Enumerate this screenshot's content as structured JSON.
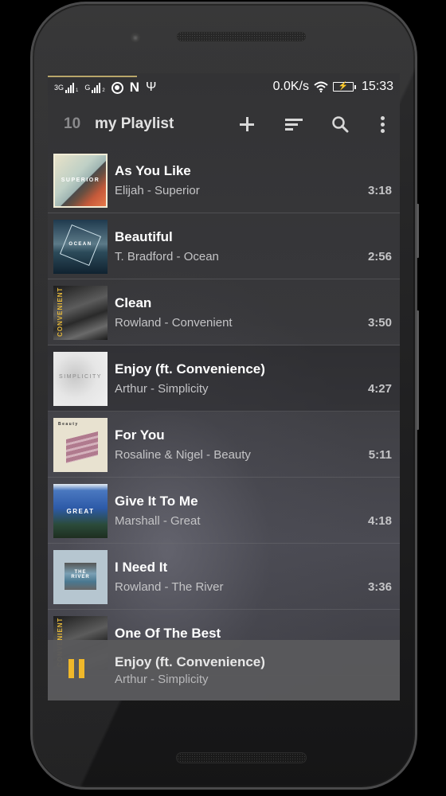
{
  "status_bar": {
    "network_1": "3G",
    "network_2": "G",
    "speed": "0.0K/s",
    "time": "15:33",
    "icons": [
      "signal-icon",
      "signal-icon",
      "sync-circle-icon",
      "n-app-icon",
      "usb-icon",
      "wifi-icon",
      "battery-charging-icon"
    ]
  },
  "app_bar": {
    "count": "10",
    "title": "my Playlist",
    "actions": [
      "add-icon",
      "sort-icon",
      "search-icon",
      "more-vert-icon"
    ]
  },
  "tracks": [
    {
      "title": "As You Like",
      "subtitle": "Elijah - Superior",
      "duration": "3:18",
      "album_text": "SUPERIOR"
    },
    {
      "title": "Beautiful",
      "subtitle": "T. Bradford - Ocean",
      "duration": "2:56",
      "album_text": "OCEAN"
    },
    {
      "title": "Clean",
      "subtitle": "Rowland - Convenient",
      "duration": "3:50",
      "album_text": "CONVENIENT"
    },
    {
      "title": "Enjoy (ft. Convenience)",
      "subtitle": "Arthur - Simplicity",
      "duration": "4:27",
      "album_text": "SIMPLICITY",
      "active": true
    },
    {
      "title": "For You",
      "subtitle": "Rosaline & Nigel - Beauty",
      "duration": "5:11",
      "album_text": "Beauty"
    },
    {
      "title": "Give It To Me",
      "subtitle": "Marshall - Great",
      "duration": "4:18",
      "album_text": "GREAT"
    },
    {
      "title": "I Need It",
      "subtitle": "Rowland - The River",
      "duration": "3:36",
      "album_text": "THE RIVER"
    },
    {
      "title": "One Of The Best",
      "subtitle": "",
      "duration": "",
      "album_text": "CONVENIENT"
    }
  ],
  "now_playing": {
    "title": "Enjoy (ft. Convenience)",
    "subtitle": "Arthur - Simplicity",
    "state": "playing",
    "accent_color": "#f0b82a"
  }
}
